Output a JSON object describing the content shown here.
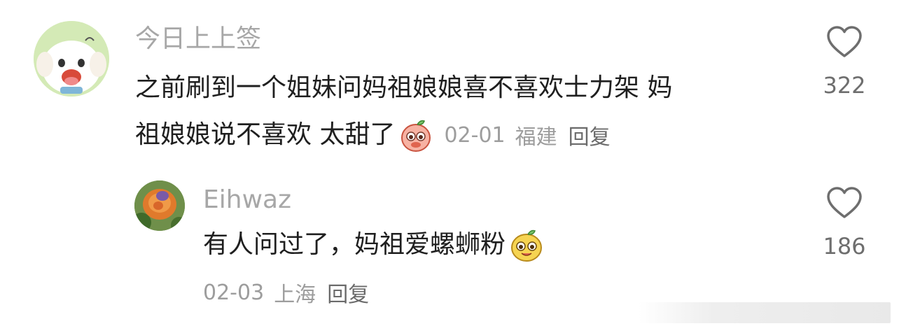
{
  "comments": [
    {
      "username": "今日上上签",
      "text_line1": "之前刷到一个姐妹问妈祖娘娘喜不喜欢士力架 妈",
      "text_line2": "祖娘娘说不喜欢 太甜了",
      "emoji": "peach-blush-emoji",
      "date": "02-01",
      "location": "福建",
      "reply_label": "回复",
      "likes": "322"
    },
    {
      "username": "Eihwaz",
      "text": "有人问过了，妈祖爱螺蛳粉",
      "emoji": "yellow-smile-emoji",
      "date": "02-03",
      "location": "上海",
      "reply_label": "回复",
      "likes": "186"
    }
  ],
  "colors": {
    "username": "#a7a7a7",
    "text": "#1f1f1f",
    "meta": "#9d9d9d",
    "likes": "#6e6e6e"
  }
}
